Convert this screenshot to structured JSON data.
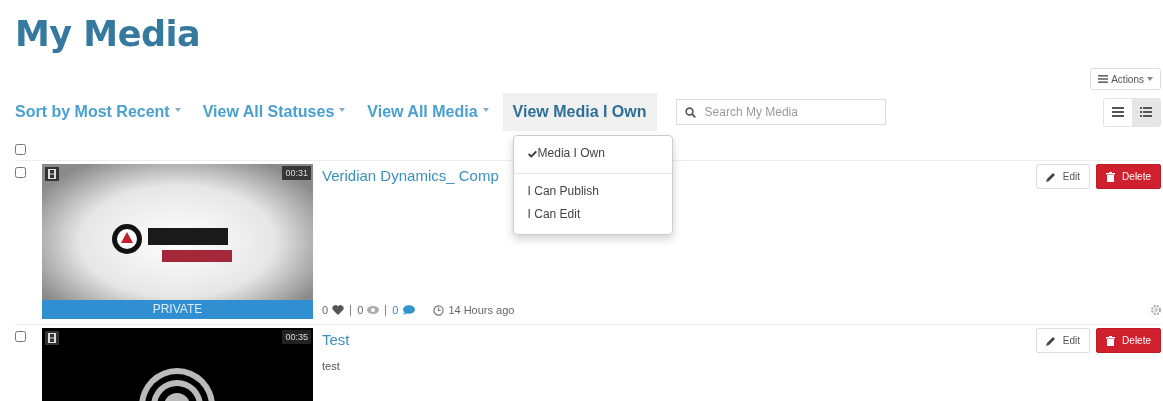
{
  "page_title": "My Media",
  "actions_button": {
    "label": "Actions"
  },
  "filters": [
    {
      "label": "Sort by Most Recent",
      "caret": true,
      "selected": false
    },
    {
      "label": "View All Statuses",
      "caret": true,
      "selected": false
    },
    {
      "label": "View All Media",
      "caret": true,
      "selected": false
    },
    {
      "label": "View Media I Own",
      "caret": false,
      "selected": true
    }
  ],
  "search": {
    "placeholder": "Search My Media"
  },
  "view_toggles": [
    {
      "selected": false
    },
    {
      "selected": true
    }
  ],
  "dropdown_menu": {
    "items": [
      {
        "label": "Media I Own",
        "checked": true
      },
      {
        "label": "I Can Publish",
        "checked": false
      },
      {
        "label": "I Can Edit",
        "checked": false
      }
    ]
  },
  "select_all": {
    "checked": false
  },
  "media": [
    {
      "checked": false,
      "duration": "00:31",
      "status": "PRIVATE",
      "title": "Veridian Dynamics_ Comp",
      "stats": {
        "likes": "0",
        "views": "0",
        "comments": "0",
        "time": "14 Hours ago"
      },
      "edit_label": "Edit",
      "delete_label": "Delete"
    },
    {
      "checked": false,
      "duration": "00:35",
      "title": "Test",
      "description": "test",
      "edit_label": "Edit",
      "delete_label": "Delete"
    }
  ]
}
